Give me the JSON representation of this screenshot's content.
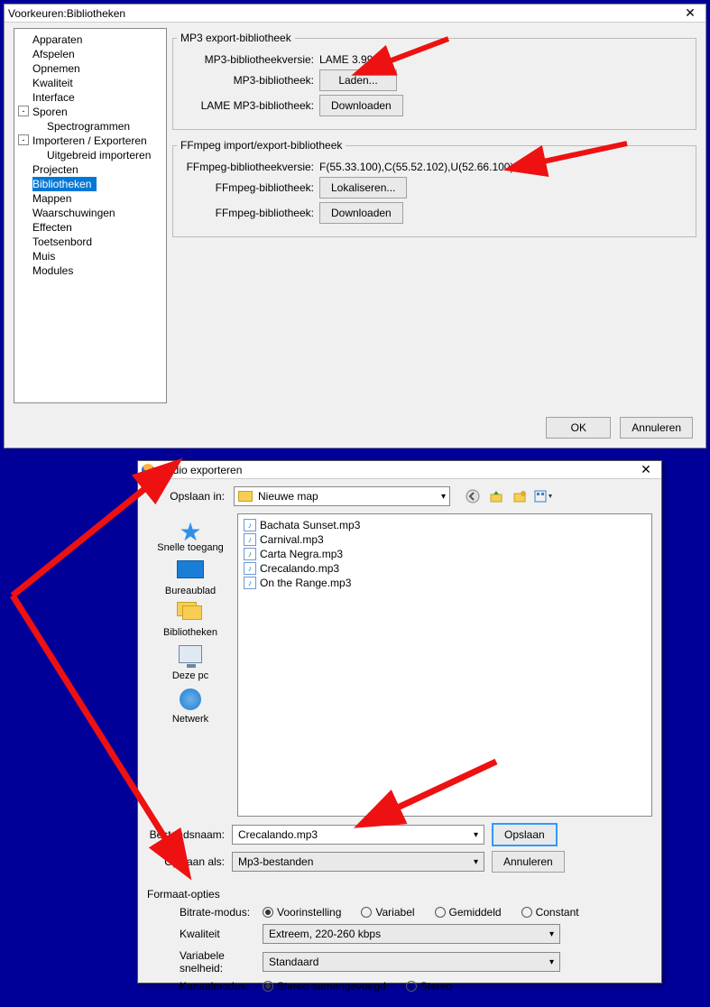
{
  "window1": {
    "title": "Voorkeuren:Bibliotheken",
    "tree": {
      "items": [
        {
          "label": "Apparaten"
        },
        {
          "label": "Afspelen"
        },
        {
          "label": "Opnemen"
        },
        {
          "label": "Kwaliteit"
        },
        {
          "label": "Interface"
        },
        {
          "label": "Sporen",
          "exp": "-",
          "children": [
            {
              "label": "Spectrogrammen"
            }
          ]
        },
        {
          "label": "Importeren / Exporteren",
          "exp": "-",
          "children": [
            {
              "label": "Uitgebreid importeren"
            }
          ]
        },
        {
          "label": "Projecten"
        },
        {
          "label": "Bibliotheken",
          "selected": true
        },
        {
          "label": "Mappen"
        },
        {
          "label": "Waarschuwingen"
        },
        {
          "label": "Effecten"
        },
        {
          "label": "Toetsenbord"
        },
        {
          "label": "Muis"
        },
        {
          "label": "Modules"
        }
      ]
    },
    "mp3": {
      "legend": "MP3 export-bibliotheek",
      "versionLabel": "MP3-bibliotheekversie:",
      "versionValue": "LAME 3.99.3",
      "libLabel": "MP3-bibliotheek:",
      "loadBtn": "Laden...",
      "lameLabel": "LAME MP3-bibliotheek:",
      "downloadBtn": "Downloaden"
    },
    "ffmpeg": {
      "legend": "FFmpeg import/export-bibliotheek",
      "versionLabel": "FFmpeg-bibliotheekversie:",
      "versionValue": "F(55.33.100),C(55.52.102),U(52.66.100)",
      "libLabel": "FFmpeg-bibliotheek:",
      "locateBtn": "Lokaliseren...",
      "libLabel2": "FFmpeg-bibliotheek:",
      "downloadBtn": "Downloaden"
    },
    "footer": {
      "ok": "OK",
      "cancel": "Annuleren"
    }
  },
  "window2": {
    "title": "Audio exporteren",
    "saveInLabel": "Opslaan in:",
    "saveInValue": "Nieuwe map",
    "places": {
      "quick": "Snelle toegang",
      "desktop": "Bureaublad",
      "libs": "Bibliotheken",
      "pc": "Deze pc",
      "net": "Netwerk"
    },
    "files": [
      "Bachata Sunset.mp3",
      "Carnival.mp3",
      "Carta Negra.mp3",
      "Crecalando.mp3",
      "On the Range.mp3"
    ],
    "filenameLabel": "Bestandsnaam:",
    "filenameValue": "Crecalando.mp3",
    "typeLabel": "Opslaan als:",
    "typeValue": "Mp3-bestanden",
    "saveBtn": "Opslaan",
    "cancelBtn": "Annuleren",
    "formatTitle": "Formaat-opties",
    "bitrateLabel": "Bitrate-modus:",
    "bitrate": {
      "preset": "Voorinstelling",
      "var": "Variabel",
      "avg": "Gemiddeld",
      "con": "Constant"
    },
    "qualityLabel": "Kwaliteit",
    "qualityValue": "Extreem, 220-260 kbps",
    "varSpeedLabel": "Variabele snelheid:",
    "varSpeedValue": "Standaard",
    "channelLabel": "Kanaalmodus:",
    "channel": {
      "joint": "Stereo samengevoegd",
      "stereo": "Stereo"
    }
  }
}
